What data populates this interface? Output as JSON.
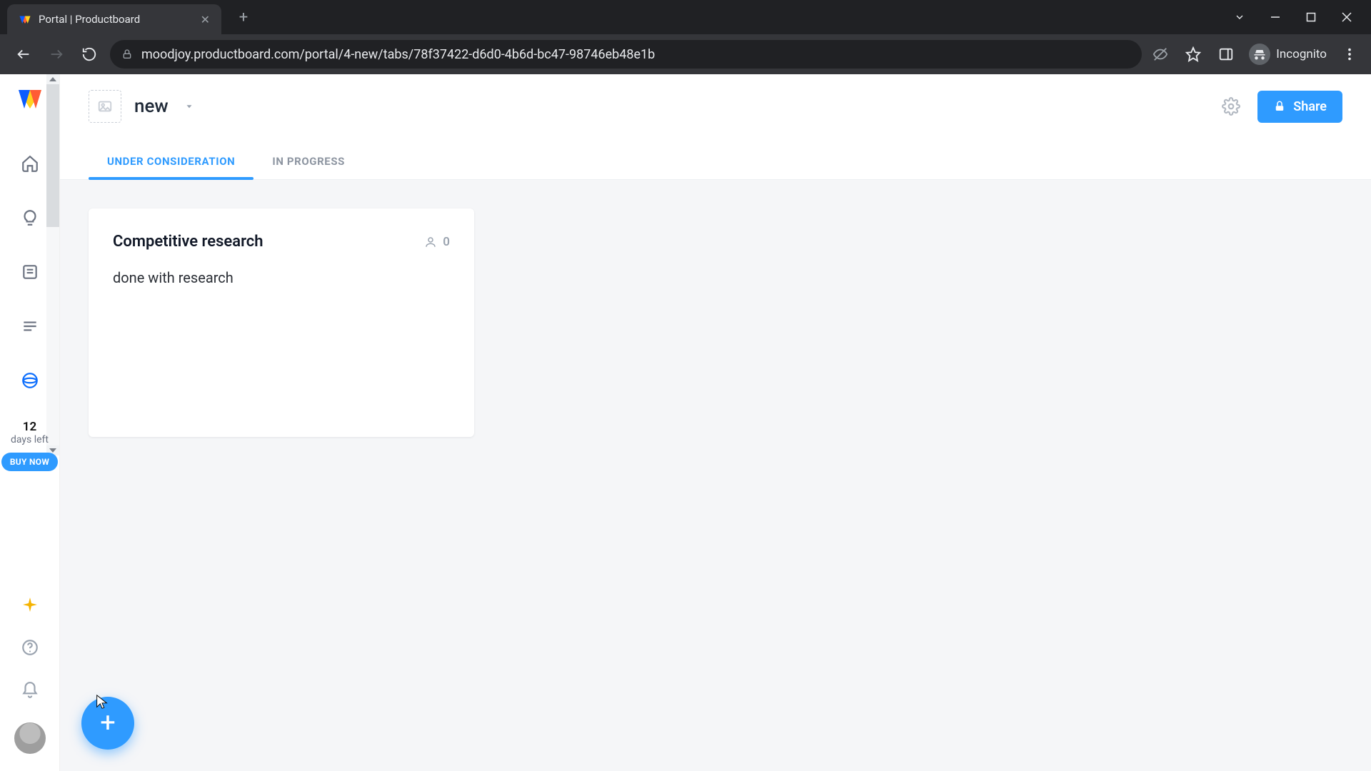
{
  "browser": {
    "tab_title": "Portal | Productboard",
    "url": "moodjoy.productboard.com/portal/4-new/tabs/78f37422-d6d0-4b6d-bc47-98746eb48e1b",
    "incognito_label": "Incognito"
  },
  "rail": {
    "trial_days": "12",
    "trial_label": "days left",
    "buy_label": "BUY NOW"
  },
  "topbar": {
    "portal_name": "new",
    "share_label": "Share"
  },
  "tabs": {
    "under_consideration": "UNDER CONSIDERATION",
    "in_progress": "IN PROGRESS"
  },
  "card": {
    "title": "Competitive research",
    "votes": "0",
    "body": "done with research"
  }
}
